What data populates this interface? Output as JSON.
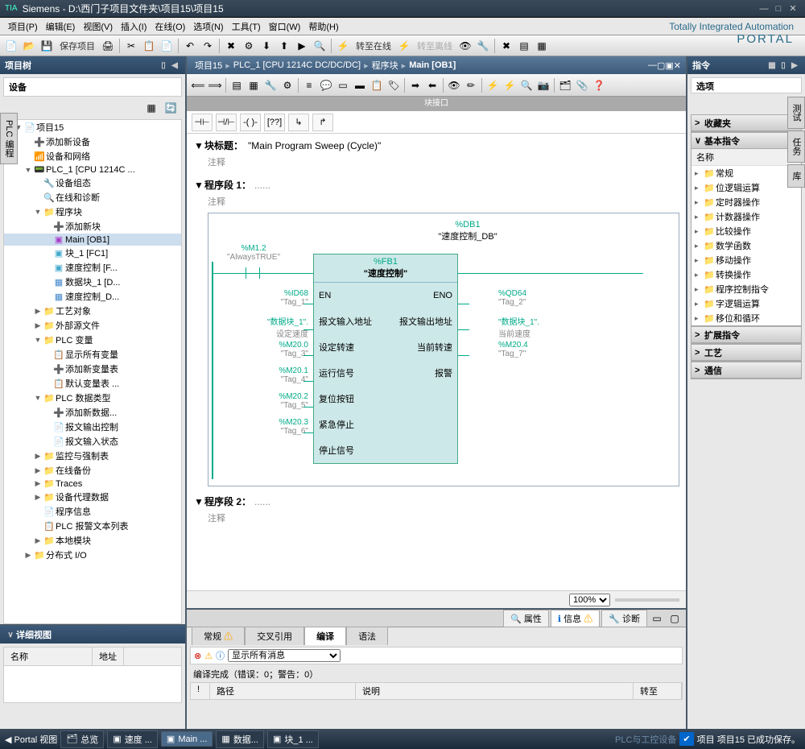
{
  "title": "Siemens  -  D:\\西门子项目文件夹\\项目15\\项目15",
  "menu": [
    "项目(P)",
    "编辑(E)",
    "视图(V)",
    "插入(I)",
    "在线(O)",
    "选项(N)",
    "工具(T)",
    "窗口(W)",
    "帮助(H)"
  ],
  "brand": {
    "l1": "Totally Integrated Automation",
    "l2": "PORTAL"
  },
  "toolbar": {
    "save": "保存项目",
    "goonline": "转至在线",
    "gooffline": "转至离线"
  },
  "left": {
    "title": "项目树",
    "device": "设备",
    "vtab": "PLC 编程",
    "tree": [
      {
        "lv": 1,
        "exp": "▼",
        "ic": "📄",
        "t": "项目15"
      },
      {
        "lv": 2,
        "exp": "",
        "ic": "➕",
        "t": "添加新设备"
      },
      {
        "lv": 2,
        "exp": "",
        "ic": "📶",
        "t": "设备和网络"
      },
      {
        "lv": 2,
        "exp": "▼",
        "ic": "📟",
        "t": "PLC_1 [CPU 1214C ..."
      },
      {
        "lv": 3,
        "exp": "",
        "ic": "🔧",
        "t": "设备组态"
      },
      {
        "lv": 3,
        "exp": "",
        "ic": "🔍",
        "t": "在线和诊断"
      },
      {
        "lv": 3,
        "exp": "▼",
        "ic": "📁",
        "t": "程序块",
        "cls": "ic-folder"
      },
      {
        "lv": 4,
        "exp": "",
        "ic": "➕",
        "t": "添加新块"
      },
      {
        "lv": 4,
        "exp": "",
        "ic": "▣",
        "t": "Main [OB1]",
        "sel": true,
        "cls": "ic-ob"
      },
      {
        "lv": 4,
        "exp": "",
        "ic": "▣",
        "t": "块_1 [FC1]",
        "cls": "ic-fc"
      },
      {
        "lv": 4,
        "exp": "",
        "ic": "▣",
        "t": "速度控制 [F...",
        "cls": "ic-fc"
      },
      {
        "lv": 4,
        "exp": "",
        "ic": "▦",
        "t": "数据块_1 [D...",
        "cls": "ic-db"
      },
      {
        "lv": 4,
        "exp": "",
        "ic": "▦",
        "t": "速度控制_D...",
        "cls": "ic-db"
      },
      {
        "lv": 3,
        "exp": "▶",
        "ic": "📁",
        "t": "工艺对象"
      },
      {
        "lv": 3,
        "exp": "▶",
        "ic": "📁",
        "t": "外部源文件"
      },
      {
        "lv": 3,
        "exp": "▼",
        "ic": "📁",
        "t": "PLC 变量"
      },
      {
        "lv": 4,
        "exp": "",
        "ic": "📋",
        "t": "显示所有变量"
      },
      {
        "lv": 4,
        "exp": "",
        "ic": "➕",
        "t": "添加新变量表"
      },
      {
        "lv": 4,
        "exp": "",
        "ic": "📋",
        "t": "默认变量表 ..."
      },
      {
        "lv": 3,
        "exp": "▼",
        "ic": "📁",
        "t": "PLC 数据类型"
      },
      {
        "lv": 4,
        "exp": "",
        "ic": "➕",
        "t": "添加新数据..."
      },
      {
        "lv": 4,
        "exp": "",
        "ic": "📄",
        "t": "报文输出控制"
      },
      {
        "lv": 4,
        "exp": "",
        "ic": "📄",
        "t": "报文输入状态"
      },
      {
        "lv": 3,
        "exp": "▶",
        "ic": "📁",
        "t": "监控与强制表"
      },
      {
        "lv": 3,
        "exp": "▶",
        "ic": "📁",
        "t": "在线备份"
      },
      {
        "lv": 3,
        "exp": "▶",
        "ic": "📁",
        "t": "Traces"
      },
      {
        "lv": 3,
        "exp": "▶",
        "ic": "📁",
        "t": "设备代理数据"
      },
      {
        "lv": 3,
        "exp": "",
        "ic": "📄",
        "t": "程序信息"
      },
      {
        "lv": 3,
        "exp": "",
        "ic": "📋",
        "t": "PLC 报警文本列表"
      },
      {
        "lv": 3,
        "exp": "▶",
        "ic": "📁",
        "t": "本地模块"
      },
      {
        "lv": 2,
        "exp": "▶",
        "ic": "📁",
        "t": "分布式 I/O"
      }
    ],
    "detail": {
      "title": "详细视图",
      "cols": [
        "名称",
        "地址"
      ]
    }
  },
  "center": {
    "bc": [
      "项目15",
      "PLC_1 [CPU 1214C DC/DC/DC]",
      "程序块",
      "Main [OB1]"
    ],
    "blkif": "块接口",
    "blktitle": {
      "lbl": "块标题：",
      "val": "\"Main Program Sweep (Cycle)\"",
      "cmt": "注释"
    },
    "net1": {
      "lbl": "程序段 1：",
      "cmt": "注释",
      "txt": "......"
    },
    "net2": {
      "lbl": "程序段 2：",
      "cmt": "注释",
      "txt": "......"
    },
    "fb": {
      "db": "%DB1",
      "dbname": "\"速度控制_DB\"",
      "type": "%FB1",
      "name": "\"速度控制\"",
      "en": "EN",
      "eno": "ENO",
      "contact": {
        "addr": "%M1.2",
        "name": "\"AlwaysTRUE\""
      },
      "inputs": [
        {
          "addr": "%ID68",
          "tag": "\"Tag_1\"",
          "pin": "报文输入地址"
        },
        {
          "addr": "\"数据块_1\".",
          "tag": "设定速度",
          "pin": "设定转速"
        },
        {
          "addr": "%M20.0",
          "tag": "\"Tag_3\"",
          "pin": "运行信号"
        },
        {
          "addr": "%M20.1",
          "tag": "\"Tag_4\"",
          "pin": "复位按钮"
        },
        {
          "addr": "%M20.2",
          "tag": "\"Tag_5\"",
          "pin": "紧急停止"
        },
        {
          "addr": "%M20.3",
          "tag": "\"Tag_6\"",
          "pin": "停止信号"
        }
      ],
      "outputs": [
        {
          "pin": "报文输出地址",
          "addr": "%QD64",
          "tag": "\"Tag_2\""
        },
        {
          "pin": "当前转速",
          "addr": "\"数据块_1\".",
          "tag": "当前速度"
        },
        {
          "pin": "报警",
          "addr": "%M20.4",
          "tag": "\"Tag_7\""
        }
      ]
    },
    "zoom": "100%"
  },
  "insp": {
    "tabs": [
      "属性",
      "信息",
      "诊断"
    ],
    "subtabs": [
      "常规",
      "交叉引用",
      "编译",
      "语法"
    ],
    "filter": "显示所有消息",
    "status": "编译完成（错误：0；警告：0）",
    "cols": [
      "路径",
      "说明",
      "转至"
    ]
  },
  "right": {
    "title": "指令",
    "opt": "选项",
    "acc": [
      {
        "t": "收藏夹",
        "open": false
      },
      {
        "t": "基本指令",
        "open": true,
        "hdr": "名称",
        "items": [
          "常规",
          "位逻辑运算",
          "定时器操作",
          "计数器操作",
          "比较操作",
          "数学函数",
          "移动操作",
          "转换操作",
          "程序控制指令",
          "字逻辑运算",
          "移位和循环"
        ]
      },
      {
        "t": "扩展指令",
        "open": false
      },
      {
        "t": "工艺",
        "open": false
      },
      {
        "t": "通信",
        "open": false
      }
    ],
    "vtabs": [
      "测试",
      "任务",
      "库"
    ]
  },
  "status": {
    "portal": "Portal 视图",
    "tabs": [
      "总览",
      "速度 ...",
      "Main ...",
      "数据...",
      "块_1 ..."
    ],
    "msg": "项目 项目15 已成功保存。",
    "watermark": "PLC与工控设备"
  }
}
